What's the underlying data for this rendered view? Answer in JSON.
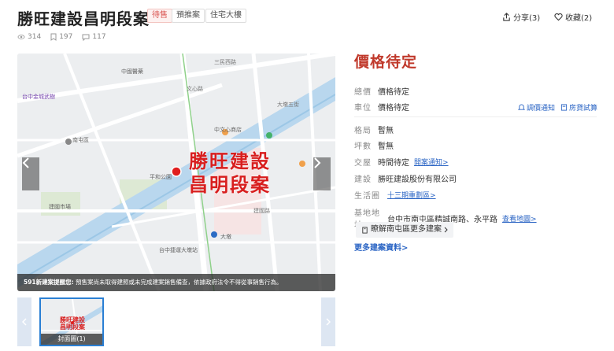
{
  "header": {
    "title": "勝旺建設昌明段案",
    "tags": [
      "待售",
      "預推案",
      "住宅大樓"
    ],
    "share_label": "分享(3)",
    "favorite_label": "收藏(2)"
  },
  "stats": {
    "views": "314",
    "saves": "197",
    "comments": "117"
  },
  "gallery": {
    "overlay_line1": "勝旺建設",
    "overlay_line2": "昌明段案",
    "disclaimer_bold": "591新建案提醒您:",
    "disclaimer_text": " 預售案尚未取得建照或未完成建案銷售備查，依據政府法令不得從事銷售行為。",
    "thumb_caption": "封面圖(1)",
    "map_labels": {
      "hall": "中國醫藥",
      "wucheng": "台中金城武樹",
      "nanqu": "南屯區",
      "jianguo": "建國市場",
      "plaza": "平和公園",
      "shopping": "中文心商店",
      "dadun": "大墩",
      "station": "台中捷運大墩站",
      "street1": "三民西路",
      "street2": "文心路",
      "street3": "建國路",
      "street4": "大墩五街"
    }
  },
  "info": {
    "price": "價格待定",
    "total_label": "總價",
    "total_value": "價格待定",
    "parking_label": "車位",
    "parking_value": "價格待定",
    "price_notify": "調價通知",
    "loan_calc": "房貸試算",
    "layout_label": "格局",
    "layout_value": "暫無",
    "area_label": "坪數",
    "area_value": "暫無",
    "handover_label": "交屋",
    "handover_value": "時間待定",
    "handover_link": "開案通知>",
    "builder_label": "建設",
    "builder_value": "勝旺建設股份有限公司",
    "zone_label": "生活圈",
    "zone_link": "十三期重劃區>",
    "address_label": "基地地址",
    "address_value": "台中市南屯區精誠南路、永平路",
    "address_link": "查看地圖>",
    "more_area_btn": "瞭解南屯區更多建案",
    "more_info_link": "更多建案資料>"
  }
}
